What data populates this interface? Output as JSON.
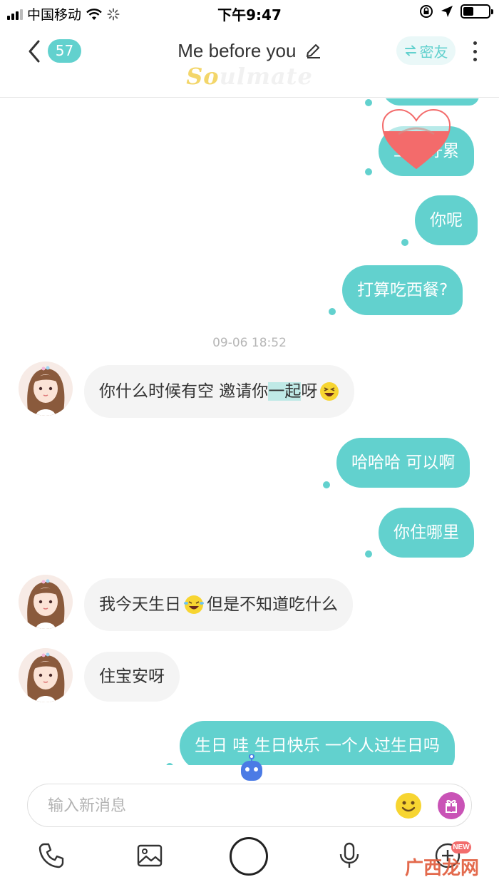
{
  "status_bar": {
    "carrier": "中国移动",
    "time": "下午9:47"
  },
  "header": {
    "unread_count": "57",
    "title": "Me before you",
    "logo_so": "So",
    "logo_rest": "ulmate",
    "friend_label": "密友"
  },
  "messages": [
    {
      "dir": "out",
      "text": "工作好累"
    },
    {
      "dir": "out",
      "text": "你呢"
    },
    {
      "dir": "out",
      "text": "打算吃西餐?"
    },
    {
      "dir": "in",
      "text_before": "你什么时候有空 邀请你",
      "text_highlight": "一起",
      "text_after": "呀"
    },
    {
      "dir": "out",
      "text": "哈哈哈 可以啊"
    },
    {
      "dir": "out",
      "text": "你住哪里"
    },
    {
      "dir": "in",
      "text_before": "我今天生日",
      "text_after": " 但是不知道吃什么"
    },
    {
      "dir": "in",
      "text": "住宝安呀"
    },
    {
      "dir": "out",
      "text": "生日 哇 生日快乐 一个人过生日吗"
    }
  ],
  "timestamp": "09-06 18:52",
  "input": {
    "placeholder": "输入新消息"
  },
  "toolbar": {
    "new_badge": "NEW"
  },
  "watermark": "广西龙网",
  "colors": {
    "accent": "#62d1ce",
    "incoming_bubble": "#f4f4f4",
    "heart": "#f36b6b",
    "gift": "#c953b6",
    "emoji": "#f7d531"
  }
}
